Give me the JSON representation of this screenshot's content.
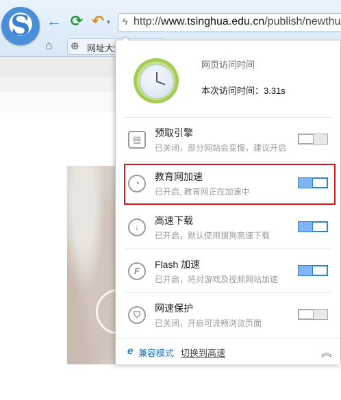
{
  "browser": {
    "address": {
      "scheme": "http://",
      "domain": "www.tsinghua.edu.cn",
      "path": "/publish/newthu/"
    },
    "bookmark_label": "网址大全"
  },
  "popup": {
    "title": "网页访问时间",
    "visit_time": "本次访问时间：3.31s",
    "rows": [
      {
        "title": "预取引擎",
        "desc": "已关闭，部分网站会变慢，建议开启",
        "enabled": false,
        "icon": "prefetch-icon"
      },
      {
        "title": "教育网加速",
        "desc": "已开启, 教育网正在加速中",
        "enabled": true,
        "icon": "speedometer-icon",
        "highlighted": true
      },
      {
        "title": "高速下载",
        "desc": "已开启，默认使用搜狗高速下载",
        "enabled": true,
        "icon": "download-icon"
      },
      {
        "title": "Flash 加速",
        "desc": "已开启，将对游戏及视频网站加速",
        "enabled": true,
        "icon": "flash-icon"
      },
      {
        "title": "网速保护",
        "desc": "已关闭，开启可流畅浏览页面",
        "enabled": false,
        "icon": "shield-icon"
      }
    ],
    "footer": {
      "compat_mode": "兼容模式",
      "switch_link": "切换到高速"
    }
  },
  "colors": {
    "toggle_on": "#7eb5f2",
    "highlight_border": "#d9151a",
    "link_blue": "#1c74c8"
  }
}
